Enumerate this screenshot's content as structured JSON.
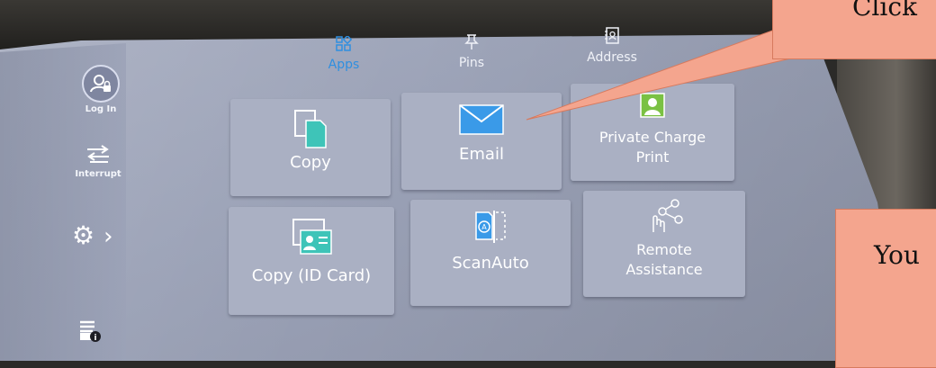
{
  "sidebar": {
    "login_label": "Log In",
    "interrupt_label": "Interrupt",
    "chevron": "›"
  },
  "topnav": [
    {
      "label": "Apps",
      "icon": "apps-grid-icon",
      "active": true
    },
    {
      "label": "Pins",
      "icon": "pin-icon",
      "active": false
    },
    {
      "label": "Address",
      "icon": "address-book-icon",
      "active": false
    }
  ],
  "tiles": [
    {
      "label": "Copy",
      "icon": "copy-icon"
    },
    {
      "label": "Email",
      "icon": "envelope-icon"
    },
    {
      "label_line1": "Private Charge",
      "label_line2": "Print",
      "icon": "user-portrait-icon"
    },
    {
      "label": "Copy (ID Card)",
      "icon": "id-card-icon"
    },
    {
      "label": "ScanAuto",
      "icon": "scan-auto-icon"
    },
    {
      "label_line1": "Remote",
      "label_line2": "Assistance",
      "icon": "share-hand-icon"
    }
  ],
  "callouts": {
    "top_text": "Click",
    "bottom_text": "You"
  },
  "colors": {
    "screen": "#9aa1b6",
    "tile": "#aab0c3",
    "active_nav": "#2f8fe0",
    "callout": "#f4a58e",
    "email_icon": "#3a9ae8",
    "copy_icon": "#3ec4b8",
    "portrait_icon": "#7ac143"
  }
}
